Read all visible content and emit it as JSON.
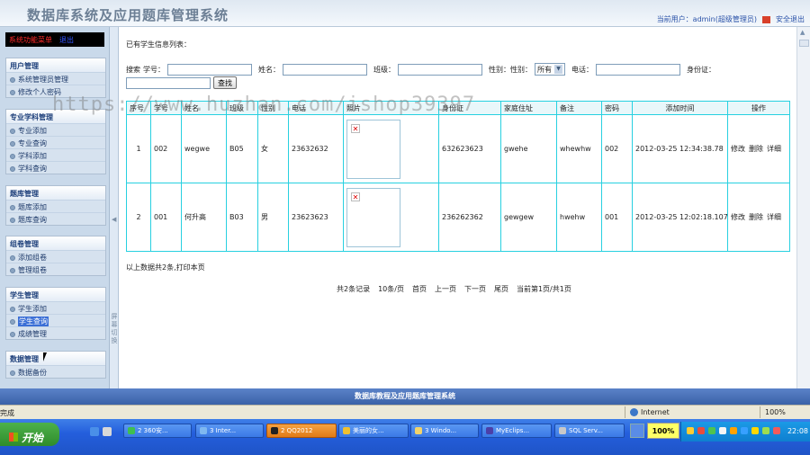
{
  "header": {
    "system_title": "数据库系统及应用题库管理系统",
    "current_user": "当前用户：admin(超级管理员)",
    "logout": "安全退出"
  },
  "sidebar": {
    "menu_head": "系统功能菜单",
    "menu_exit": "退出",
    "toggle_text": "屏幕切换",
    "groups": [
      {
        "title": "用户管理",
        "items": [
          "系统管理员管理",
          "修改个人密码"
        ]
      },
      {
        "title": "专业学科管理",
        "items": [
          "专业添加",
          "专业查询",
          "学科添加",
          "学科查询"
        ]
      },
      {
        "title": "题库管理",
        "items": [
          "题库添加",
          "题库查询"
        ]
      },
      {
        "title": "组卷管理",
        "items": [
          "添加组卷",
          "管理组卷"
        ]
      },
      {
        "title": "学生管理",
        "items": [
          "学生添加",
          "学生查询",
          "成绩管理"
        ]
      },
      {
        "title": "数据管理",
        "items": [
          "数据备份"
        ]
      }
    ],
    "selected_item": "学生查询"
  },
  "main": {
    "list_title": "已有学生信息列表：",
    "search": {
      "label_search": "搜索",
      "label_id": "学号：",
      "label_name": "姓名：",
      "label_class": "班级：",
      "label_gender": "性别：性别：",
      "gender_value": "所有",
      "label_phone": "电话：",
      "label_idcard": "身份证：",
      "button": "查找"
    },
    "table": {
      "headers": [
        "序号",
        "学号",
        "姓名",
        "班级",
        "性别",
        "电话",
        "照片",
        "身份证",
        "家庭住址",
        "备注",
        "密码",
        "添加时间",
        "操作"
      ],
      "rows": [
        {
          "index": "1",
          "sid": "002",
          "name": "wegwe",
          "class": "B05",
          "gender": "女",
          "phone": "23632632",
          "idcard": "632623623",
          "address": "gwehe",
          "remark": "whewhw",
          "password": "002",
          "added": "2012-03-25 12:34:38.78",
          "ops": [
            "修改",
            "删除",
            "详细"
          ]
        },
        {
          "index": "2",
          "sid": "001",
          "name": "何升高",
          "class": "B03",
          "gender": "男",
          "phone": "23623623",
          "idcard": "236262362",
          "address": "gewgew",
          "remark": "hwehw",
          "password": "001",
          "added": "2012-03-25 12:02:18.107",
          "ops": [
            "修改",
            "删除",
            "详细"
          ]
        }
      ]
    },
    "summary": "以上数据共2条,打印本页",
    "pager": [
      "共2条记录",
      "10条/页",
      "首页",
      "上一页",
      "下一页",
      "尾页",
      "当前第1页/共1页"
    ]
  },
  "footer": {
    "text": "数据库教程及应用题库管理系统"
  },
  "statusbar": {
    "left": "完成",
    "zone": "Internet",
    "zoom": "100%"
  },
  "taskbar": {
    "start": "开始",
    "tasks": [
      "2 360安...",
      "3 Inter...",
      "2 QQ2012",
      "美丽的女...",
      "3 Windo...",
      "MyEclips...",
      "SQL Serv..."
    ],
    "tray_percent": "100%",
    "clock": "22:08"
  },
  "watermark": "https://www.huzhan.com/ishop39397",
  "colors": {
    "table_border": "#27d0e0",
    "footer_bg": "#3a62a8",
    "taskbar_bg": "#245edc"
  }
}
